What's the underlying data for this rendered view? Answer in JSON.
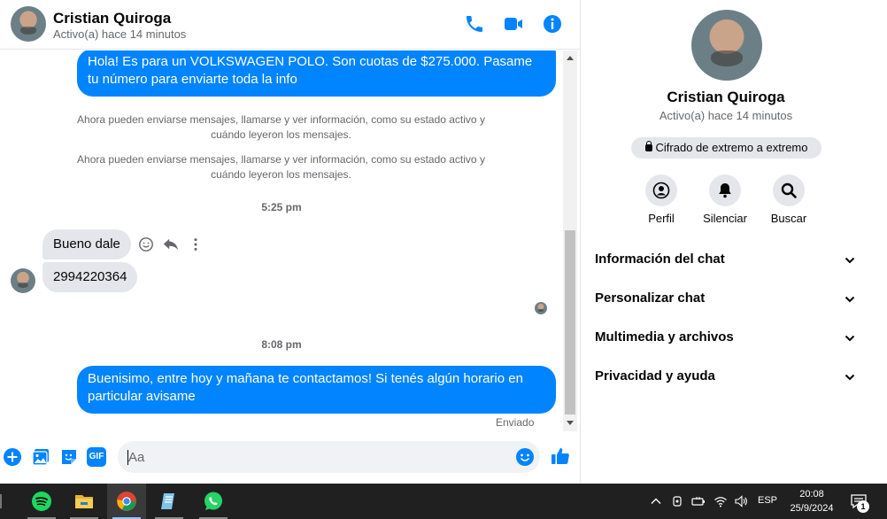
{
  "contact": {
    "name": "Cristian Quiroga",
    "status": "Activo(a) hace 14 minutos"
  },
  "header": {
    "call_icon": "phone-icon",
    "video_icon": "video-camera-icon",
    "info_icon": "info-icon"
  },
  "messages": {
    "outgoing_1": "Hola! Es para un VOLKSWAGEN POLO. Son cuotas de $275.000. Pasame tu número para enviarte toda la info",
    "system_1": "Ahora pueden enviarse mensajes, llamarse y ver información, como su estado activo y cuándo leyeron los mensajes.",
    "system_2": "Ahora pueden enviarse mensajes, llamarse y ver información, como su estado activo y cuándo leyeron los mensajes.",
    "time_1": "5:25 pm",
    "incoming_1": "Bueno dale",
    "incoming_2": "2994220364",
    "time_2": "8:08 pm",
    "outgoing_2": "Buenisimo, entre hoy y mañana te contactamos! Si tenés algún horario en particular avisame",
    "sent_label": "Enviado"
  },
  "composer": {
    "placeholder": "Aa",
    "gif_label": "GIF"
  },
  "panel": {
    "name": "Cristian Quiroga",
    "status": "Activo(a) hace 14 minutos",
    "encryption": "Cifrado de extremo a extremo",
    "actions": [
      {
        "label": "Perfil",
        "icon": "profile-icon"
      },
      {
        "label": "Silenciar",
        "icon": "bell-icon"
      },
      {
        "label": "Buscar",
        "icon": "search-icon"
      }
    ],
    "sections": [
      {
        "label": "Información del chat"
      },
      {
        "label": "Personalizar chat"
      },
      {
        "label": "Multimedia y archivos"
      },
      {
        "label": "Privacidad y ayuda"
      }
    ]
  },
  "taskbar": {
    "apps": [
      "spotify-icon",
      "file-explorer-icon",
      "chrome-icon",
      "notes-icon",
      "whatsapp-icon"
    ],
    "language": "ESP",
    "time": "20:08",
    "date": "25/9/2024",
    "notification_count": "1"
  },
  "colors": {
    "accent": "#0084ff",
    "bubble_in": "#e4e6eb",
    "secondary_text": "#65676b",
    "taskbar": "#202020"
  }
}
